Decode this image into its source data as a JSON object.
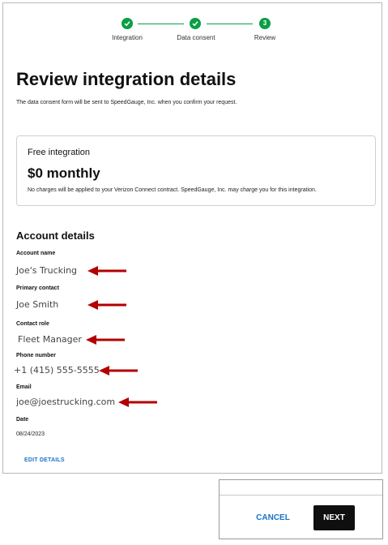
{
  "stepper": {
    "steps": [
      {
        "label": "Integration",
        "status": "complete"
      },
      {
        "label": "Data consent",
        "status": "complete"
      },
      {
        "label": "Review",
        "status": "current",
        "number": "3"
      }
    ]
  },
  "page": {
    "title": "Review integration details",
    "intro": "The data consent form will be sent to SpeedGauge, Inc. when you confirm your request."
  },
  "card": {
    "label": "Free integration",
    "price": "$0 monthly",
    "note": "No charges will be applied to your Verizon Connect contract. SpeedGauge, Inc. may charge you for this integration."
  },
  "account": {
    "title": "Account details",
    "fields": [
      {
        "label": "Account name",
        "value": "Joe's Trucking"
      },
      {
        "label": "Primary contact",
        "value": "Joe Smith"
      },
      {
        "label": "Contact role",
        "value": "Fleet Manager"
      },
      {
        "label": "Phone number",
        "value": "+1 (415) 555-5555"
      },
      {
        "label": "Email",
        "value": "joe@joestrucking.com"
      },
      {
        "label": "Date",
        "value": "08/24/2023"
      }
    ],
    "edit_label": "EDIT DETAILS"
  },
  "footer": {
    "cancel_label": "CANCEL",
    "next_label": "NEXT"
  },
  "colors": {
    "step_green": "#0a9e45",
    "annotation_arrow": "#b30000",
    "link_blue": "#1a73c7",
    "primary_button": "#0f0f0f"
  },
  "icons": [
    "check-icon",
    "annotation-arrow-icon"
  ]
}
